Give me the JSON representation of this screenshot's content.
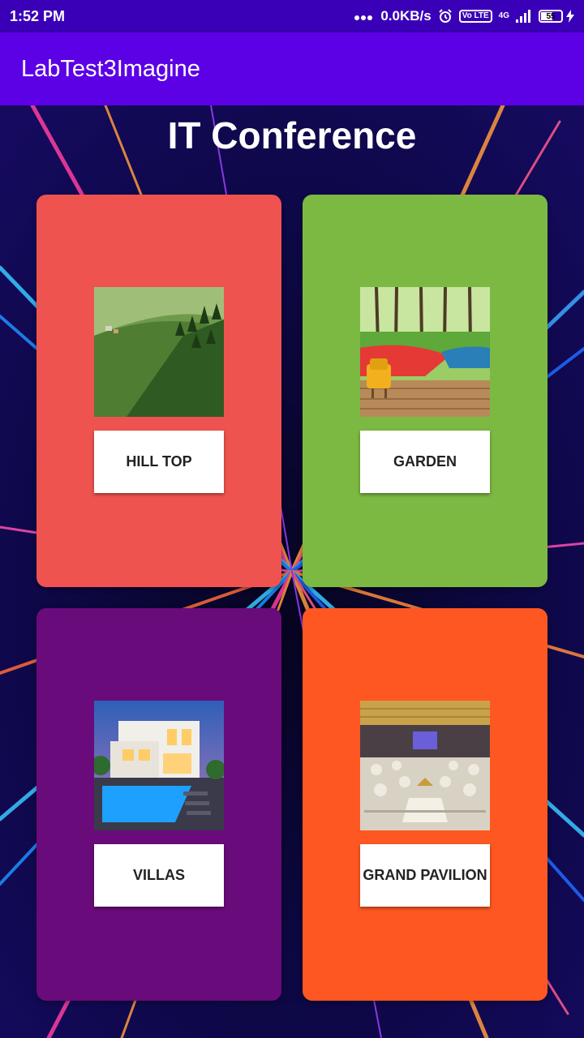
{
  "status_bar": {
    "time": "1:52 PM",
    "net_speed": "0.0KB/s",
    "volte": "Vo LTE",
    "network": "4G",
    "battery": "55"
  },
  "app_bar": {
    "title": "LabTest3Imagine"
  },
  "page": {
    "title": "IT Conference"
  },
  "colors": {
    "status_bar": "#3a00b8",
    "app_bar": "#5c00e6",
    "card_hilltop": "#ef5350",
    "card_garden": "#7cb942",
    "card_villas": "#6a0b7b",
    "card_pavilion": "#ff5722"
  },
  "venues": [
    {
      "label": "HILL TOP",
      "image": "hilltop-landscape"
    },
    {
      "label": "GARDEN",
      "image": "garden-park"
    },
    {
      "label": "VILLAS",
      "image": "villa-pool"
    },
    {
      "label": "GRAND PAVILION",
      "image": "banquet-hall"
    }
  ]
}
